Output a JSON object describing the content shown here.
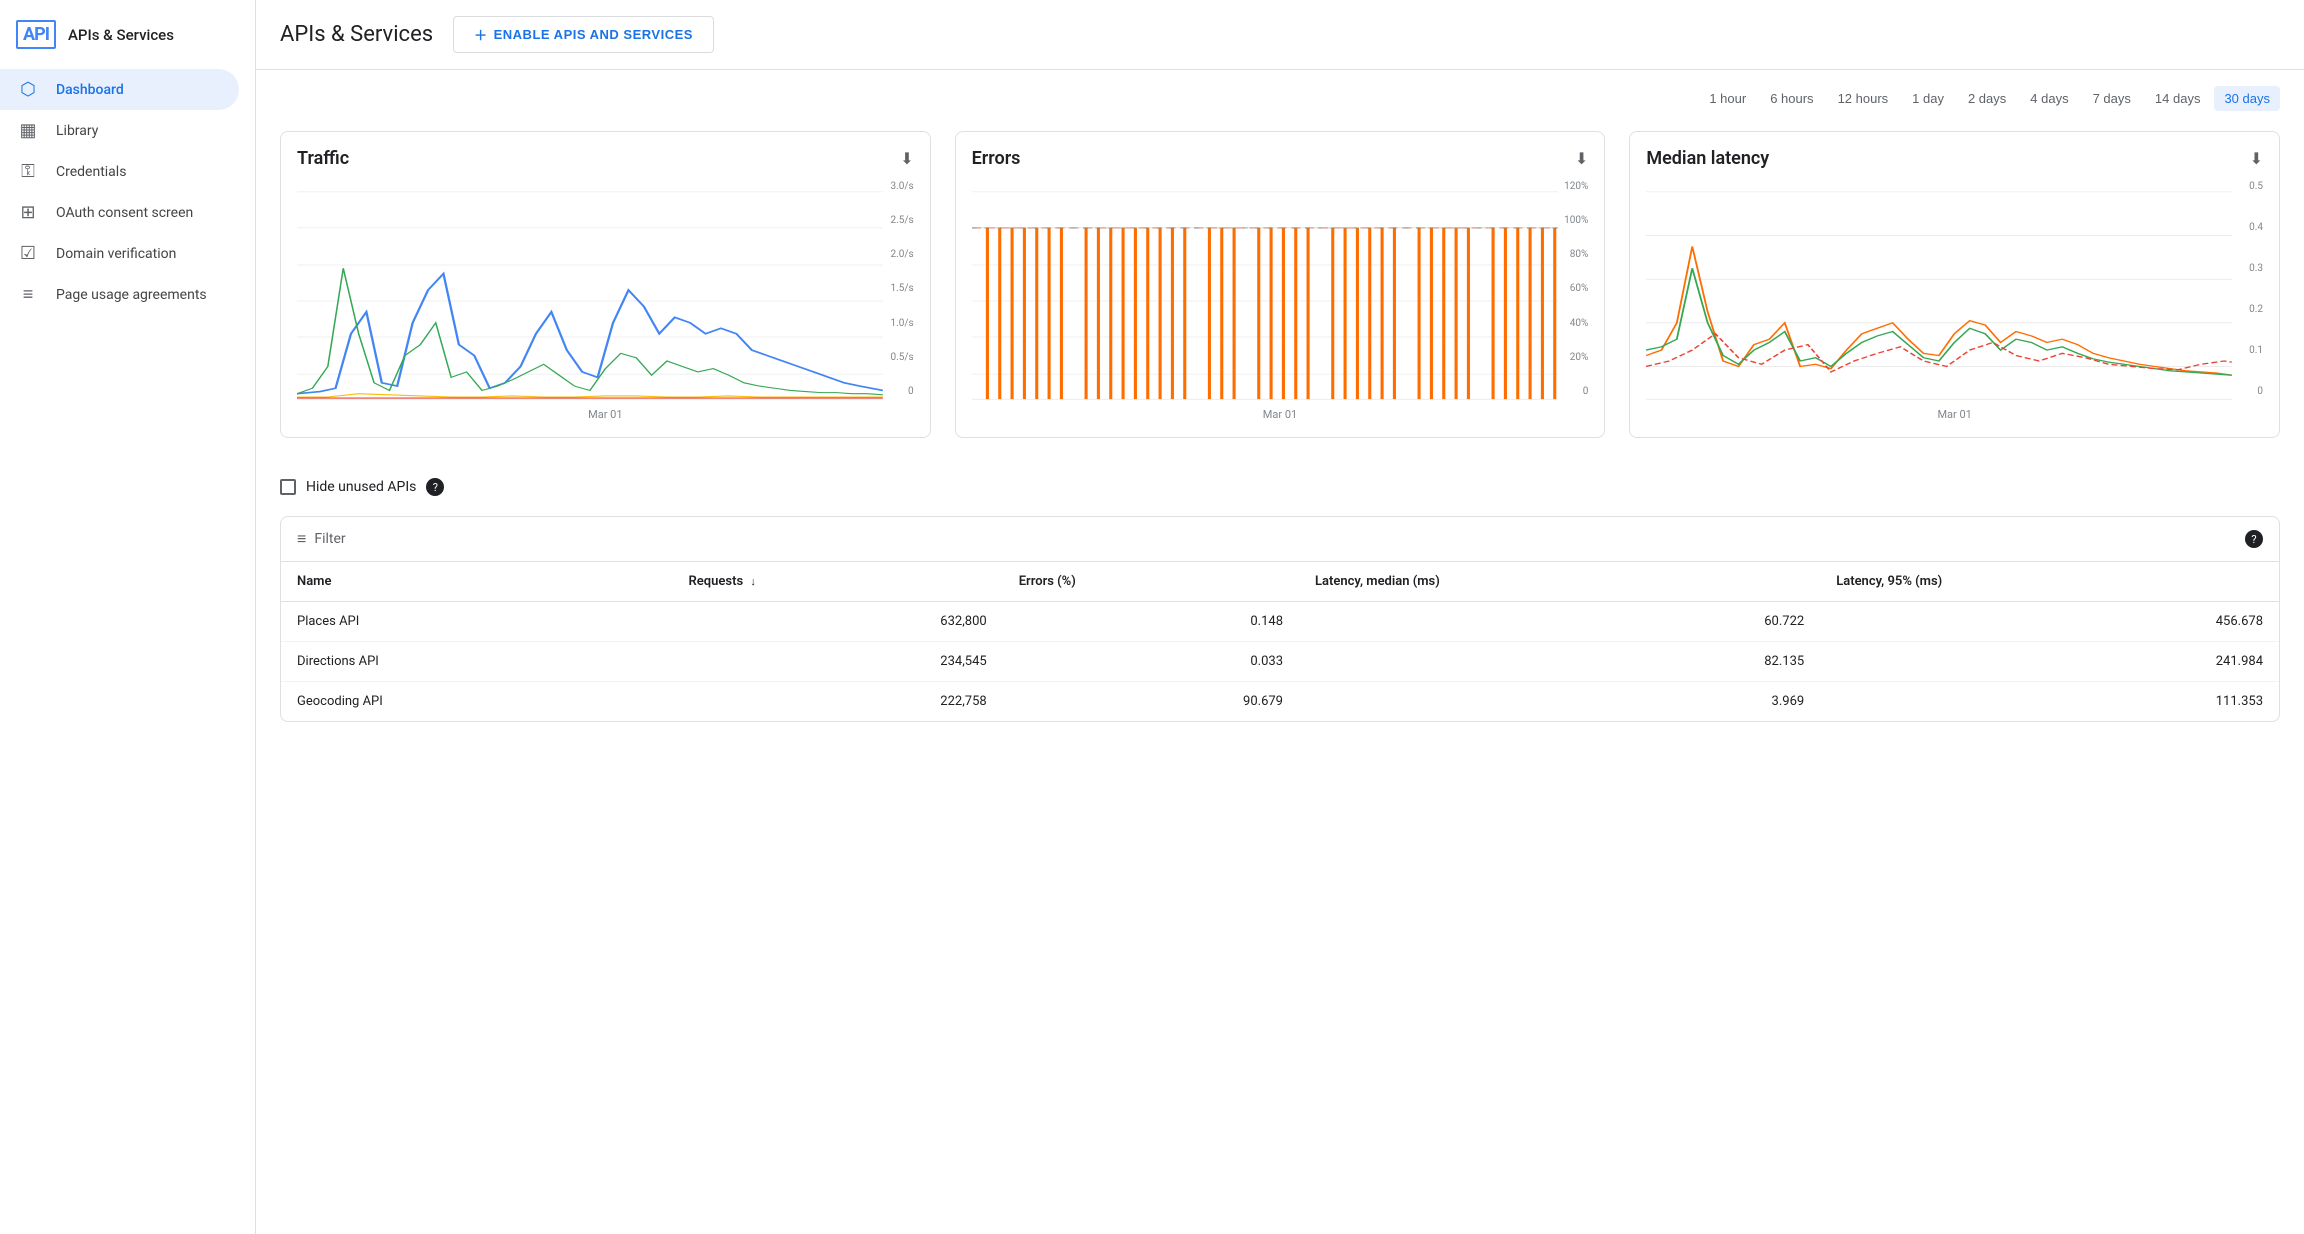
{
  "sidebar": {
    "logo_text": "API",
    "title": "APIs & Services",
    "nav_items": [
      {
        "id": "dashboard",
        "label": "Dashboard",
        "icon": "⬡",
        "active": true
      },
      {
        "id": "library",
        "label": "Library",
        "icon": "▦",
        "active": false
      },
      {
        "id": "credentials",
        "label": "Credentials",
        "icon": "⚿",
        "active": false
      },
      {
        "id": "oauth",
        "label": "OAuth consent screen",
        "icon": "⊞",
        "active": false
      },
      {
        "id": "domain",
        "label": "Domain verification",
        "icon": "☑",
        "active": false
      },
      {
        "id": "page-usage",
        "label": "Page usage agreements",
        "icon": "≡",
        "active": false
      }
    ]
  },
  "header": {
    "title": "APIs & Services",
    "enable_button_label": "ENABLE APIS AND SERVICES"
  },
  "time_filters": {
    "options": [
      {
        "id": "1hour",
        "label": "1 hour",
        "active": false
      },
      {
        "id": "6hours",
        "label": "6 hours",
        "active": false
      },
      {
        "id": "12hours",
        "label": "12 hours",
        "active": false
      },
      {
        "id": "1day",
        "label": "1 day",
        "active": false
      },
      {
        "id": "2days",
        "label": "2 days",
        "active": false
      },
      {
        "id": "4days",
        "label": "4 days",
        "active": false
      },
      {
        "id": "7days",
        "label": "7 days",
        "active": false
      },
      {
        "id": "14days",
        "label": "14 days",
        "active": false
      },
      {
        "id": "30days",
        "label": "30 days",
        "active": true
      }
    ]
  },
  "charts": {
    "traffic": {
      "title": "Traffic",
      "x_label": "Mar 01",
      "y_labels": [
        "3.0/s",
        "2.5/s",
        "2.0/s",
        "1.5/s",
        "1.0/s",
        "0.5/s",
        "0"
      ]
    },
    "errors": {
      "title": "Errors",
      "x_label": "Mar 01",
      "y_labels": [
        "120%",
        "100%",
        "80%",
        "60%",
        "40%",
        "20%",
        "0"
      ]
    },
    "latency": {
      "title": "Median latency",
      "x_label": "Mar 01",
      "y_labels": [
        "0.5",
        "0.4",
        "0.3",
        "0.2",
        "0.1",
        "0"
      ]
    }
  },
  "hide_unused": {
    "label": "Hide unused APIs",
    "checked": false
  },
  "table": {
    "filter_placeholder": "Filter",
    "columns": [
      {
        "id": "name",
        "label": "Name",
        "sortable": false
      },
      {
        "id": "requests",
        "label": "Requests",
        "sortable": true
      },
      {
        "id": "errors",
        "label": "Errors (%)",
        "sortable": false
      },
      {
        "id": "latency_median",
        "label": "Latency, median (ms)",
        "sortable": false
      },
      {
        "id": "latency_95",
        "label": "Latency, 95% (ms)",
        "sortable": false
      }
    ],
    "rows": [
      {
        "name": "Places API",
        "requests": "632,800",
        "errors": "0.148",
        "latency_median": "60.722",
        "latency_95": "456.678"
      },
      {
        "name": "Directions API",
        "requests": "234,545",
        "errors": "0.033",
        "latency_median": "82.135",
        "latency_95": "241.984"
      },
      {
        "name": "Geocoding API",
        "requests": "222,758",
        "errors": "90.679",
        "latency_median": "3.969",
        "latency_95": "111.353"
      }
    ]
  }
}
